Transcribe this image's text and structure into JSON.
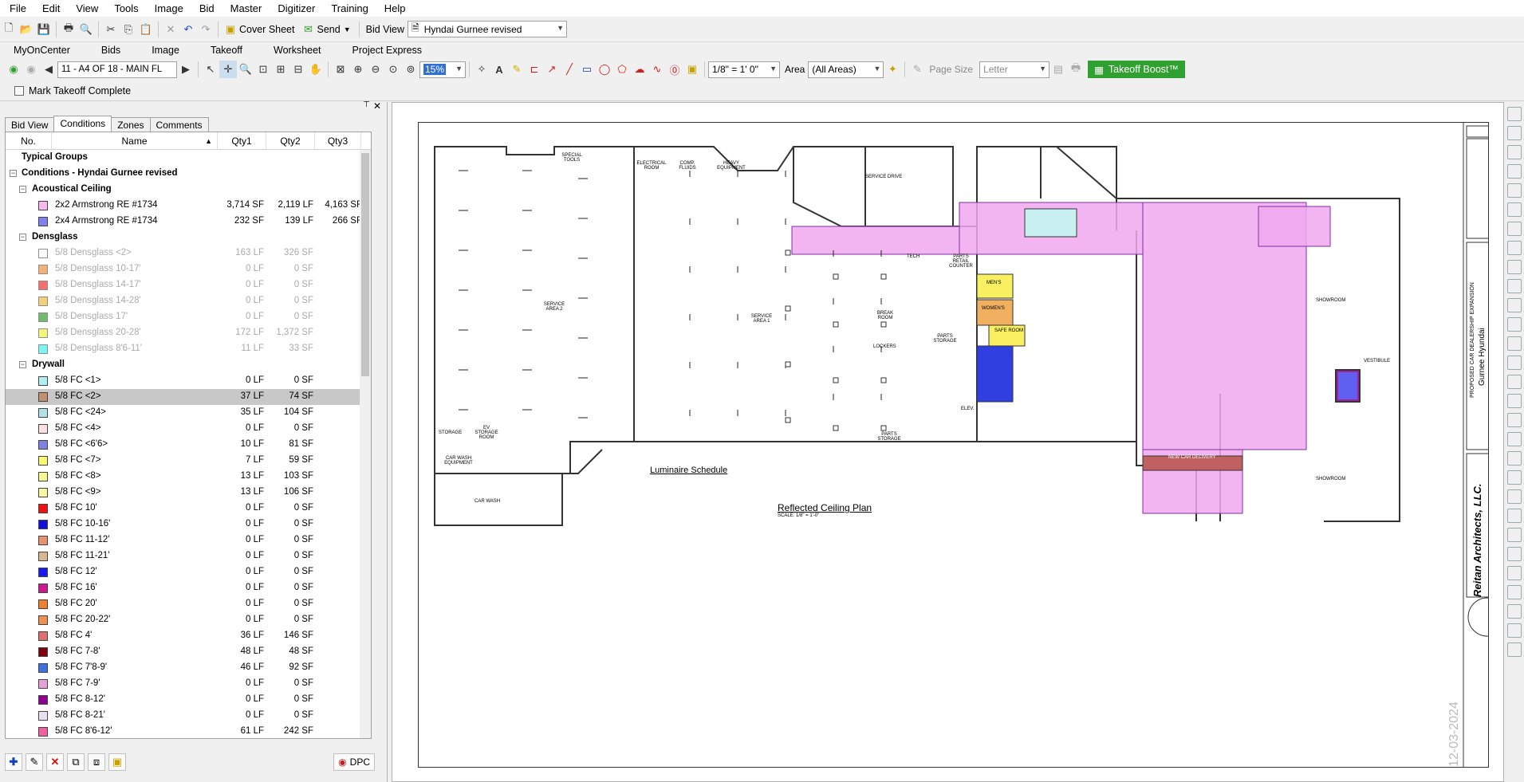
{
  "menu": [
    "File",
    "Edit",
    "View",
    "Tools",
    "Image",
    "Bid",
    "Master",
    "Digitizer",
    "Training",
    "Help"
  ],
  "toolbar1": {
    "cover_sheet": "Cover Sheet",
    "send": "Send",
    "bid_view_label": "Bid View",
    "bid_view_value": "Hyndai Gurnee revised"
  },
  "tabs": [
    "MyOnCenter",
    "Bids",
    "Image",
    "Takeoff",
    "Worksheet",
    "Project Express"
  ],
  "toolbar2": {
    "page_select": "11 - A4 OF 18 - MAIN FL",
    "zoom": "15%",
    "scale": "1/8\" = 1' 0\"",
    "area_label": "Area",
    "area_value": "(All Areas)",
    "page_size_label": "Page Size",
    "page_size_value": "Letter",
    "boost": "Takeoff Boost™"
  },
  "toolbar3": {
    "mark_complete": "Mark Takeoff Complete"
  },
  "panel": {
    "tabs": [
      "Bid View",
      "Conditions",
      "Zones",
      "Comments"
    ],
    "columns": [
      "No.",
      "Name",
      "Qty1",
      "Qty2",
      "Qty3"
    ],
    "typical_groups": "Typical Groups",
    "conditions_root": "Conditions - Hyndai Gurnee revised",
    "groups": [
      {
        "name": "Acoustical Ceiling",
        "rows": [
          {
            "name": "2x2 Armstrong RE #1734",
            "q1": "3,714 SF",
            "q2": "2,119 LF",
            "q3": "4,163 SF",
            "color": "#f8b8f0",
            "dim": false
          },
          {
            "name": "2x4 Armstrong RE #1734",
            "q1": "232 SF",
            "q2": "139 LF",
            "q3": "266 SF",
            "color": "#8080f0",
            "dim": false
          }
        ]
      },
      {
        "name": "Densglass",
        "rows": [
          {
            "name": "5/8 Densglass <2>",
            "q1": "163 LF",
            "q2": "326 SF",
            "q3": "",
            "color": "#ffffff",
            "dim": true
          },
          {
            "name": "5/8 Densglass 10-17'",
            "q1": "0 LF",
            "q2": "0 SF",
            "q3": "",
            "color": "#f08020",
            "dim": true
          },
          {
            "name": "5/8 Densglass 14-17'",
            "q1": "0 LF",
            "q2": "0 SF",
            "q3": "",
            "color": "#f01010",
            "dim": true
          },
          {
            "name": "5/8 Densglass 14-28'",
            "q1": "0 LF",
            "q2": "0 SF",
            "q3": "",
            "color": "#f0b020",
            "dim": true
          },
          {
            "name": "5/8 Densglass 17'",
            "q1": "0 LF",
            "q2": "0 SF",
            "q3": "",
            "color": "#109010",
            "dim": true
          },
          {
            "name": "5/8 Densglass 20-28'",
            "q1": "172 LF",
            "q2": "1,372 SF",
            "q3": "",
            "color": "#f0f020",
            "dim": true
          },
          {
            "name": "5/8 Densglass 8'6-11'",
            "q1": "11 LF",
            "q2": "33 SF",
            "q3": "",
            "color": "#20f0f0",
            "dim": true
          }
        ]
      },
      {
        "name": "Drywall",
        "rows": [
          {
            "name": "5/8 FC <1>",
            "q1": "0 LF",
            "q2": "0 SF",
            "q3": "",
            "color": "#b0f0f0",
            "dim": false
          },
          {
            "name": "5/8 FC <2>",
            "q1": "37 LF",
            "q2": "74 SF",
            "q3": "",
            "color": "#c09070",
            "dim": false,
            "selected": true
          },
          {
            "name": "5/8 FC <24>",
            "q1": "35 LF",
            "q2": "104 SF",
            "q3": "",
            "color": "#b0e0e8",
            "dim": false
          },
          {
            "name": "5/8 FC <4>",
            "q1": "0 LF",
            "q2": "0 SF",
            "q3": "",
            "color": "#ffe0e0",
            "dim": false
          },
          {
            "name": "5/8 FC <6'6>",
            "q1": "10 LF",
            "q2": "81 SF",
            "q3": "",
            "color": "#8080e0",
            "dim": false
          },
          {
            "name": "5/8 FC <7>",
            "q1": "7 LF",
            "q2": "59 SF",
            "q3": "",
            "color": "#f8f870",
            "dim": false
          },
          {
            "name": "5/8 FC <8>",
            "q1": "13 LF",
            "q2": "103 SF",
            "q3": "",
            "color": "#f8f890",
            "dim": false
          },
          {
            "name": "5/8 FC <9>",
            "q1": "13 LF",
            "q2": "106 SF",
            "q3": "",
            "color": "#f8f8a0",
            "dim": false
          },
          {
            "name": "5/8 FC 10'",
            "q1": "0 LF",
            "q2": "0 SF",
            "q3": "",
            "color": "#f01010",
            "dim": false
          },
          {
            "name": "5/8 FC 10-16'",
            "q1": "0 LF",
            "q2": "0 SF",
            "q3": "",
            "color": "#1010e0",
            "dim": false
          },
          {
            "name": "5/8 FC 11-12'",
            "q1": "0 LF",
            "q2": "0 SF",
            "q3": "",
            "color": "#e89070",
            "dim": false
          },
          {
            "name": "5/8 FC 11-21'",
            "q1": "0 LF",
            "q2": "0 SF",
            "q3": "",
            "color": "#d8b890",
            "dim": false
          },
          {
            "name": "5/8 FC 12'",
            "q1": "0 LF",
            "q2": "0 SF",
            "q3": "",
            "color": "#1818f0",
            "dim": false
          },
          {
            "name": "5/8 FC 16'",
            "q1": "0 LF",
            "q2": "0 SF",
            "q3": "",
            "color": "#d01890",
            "dim": false
          },
          {
            "name": "5/8 FC 20'",
            "q1": "0 LF",
            "q2": "0 SF",
            "q3": "",
            "color": "#f08030",
            "dim": false
          },
          {
            "name": "5/8 FC 20-22'",
            "q1": "0 LF",
            "q2": "0 SF",
            "q3": "",
            "color": "#f09050",
            "dim": false
          },
          {
            "name": "5/8 FC 4'",
            "q1": "36 LF",
            "q2": "146 SF",
            "q3": "",
            "color": "#e07070",
            "dim": false
          },
          {
            "name": "5/8 FC 7-8'",
            "q1": "48 LF",
            "q2": "48 SF",
            "q3": "",
            "color": "#800010",
            "dim": false
          },
          {
            "name": "5/8 FC 7'8-9'",
            "q1": "46 LF",
            "q2": "92 SF",
            "q3": "",
            "color": "#4070e0",
            "dim": false
          },
          {
            "name": "5/8 FC 7-9'",
            "q1": "0 LF",
            "q2": "0 SF",
            "q3": "",
            "color": "#e8a0d8",
            "dim": false
          },
          {
            "name": "5/8 FC 8-12'",
            "q1": "0 LF",
            "q2": "0 SF",
            "q3": "",
            "color": "#900090",
            "dim": false
          },
          {
            "name": "5/8 FC 8-21'",
            "q1": "0 LF",
            "q2": "0 SF",
            "q3": "",
            "color": "#e8e0f0",
            "dim": false
          },
          {
            "name": "5/8 FC 8'6-12'",
            "q1": "61 LF",
            "q2": "242 SF",
            "q3": "",
            "color": "#f060a0",
            "dim": false
          }
        ]
      }
    ],
    "dpc": "DPC"
  },
  "drawing": {
    "title": "Reflected Ceiling Plan",
    "scale_note": "SCALE: 1/8\" = 1'-0\"",
    "luminaire_title": "Luminaire Schedule",
    "firm": "Reitan Architects, LLC.",
    "project": "PROPOSED CAR DEALERSHIP EXPANSION",
    "client": "Gurnee Hyundai",
    "date_stamp": "12-03-2024",
    "rooms": [
      "SERVICE AREA 2",
      "SERVICE AREA 1",
      "SERVICE DRIVE",
      "SHOWROOM",
      "SHOWROOM",
      "NEW CAR DELIVERY",
      "CAR WASH",
      "STORAGE",
      "EV STORAGE ROOM",
      "CAR WASH EQUIPMENT",
      "SPECIAL TOOLS",
      "ELECTRICAL ROOM",
      "COMP. FLUIDS",
      "HEAVY EQUIPMENT",
      "PARTS STORAGE",
      "BREAK ROOM",
      "VESTIBULE",
      "MEN'S",
      "WOMEN'S",
      "SAFE ROOM",
      "TECH",
      "PARTS RETAIL COUNTER",
      "ELEV.",
      "LOCKERS",
      "PARTS STORAGE"
    ]
  },
  "colors": {
    "pink": "#f0a8f0",
    "blue": "#3040e0",
    "yellow": "#f8f060",
    "orange": "#f0b060",
    "brick": "#c06060",
    "boost": "#30a030"
  }
}
